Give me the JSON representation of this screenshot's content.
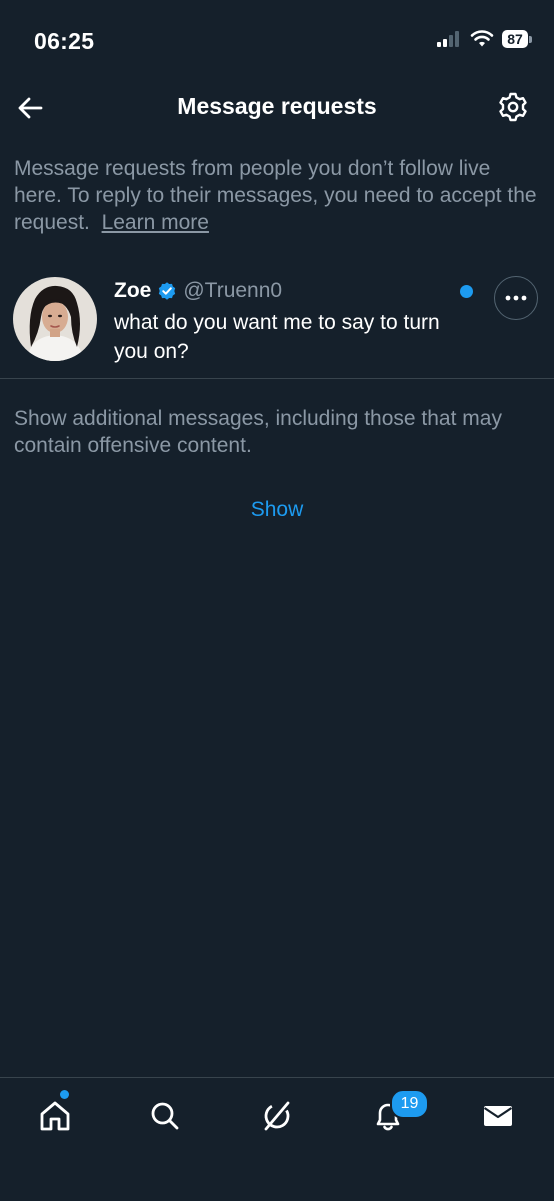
{
  "status_bar": {
    "time": "06:25",
    "battery_level": "87",
    "icons": [
      "cellular-signal-icon",
      "wifi-icon",
      "battery-icon"
    ]
  },
  "header": {
    "title": "Message requests",
    "back_icon": "arrow-left-icon",
    "settings_icon": "gear-icon"
  },
  "intro": {
    "text": "Message requests from people you don’t follow live here. To reply to their messages, you need to accept the request.",
    "learn_more": "Learn more"
  },
  "requests": [
    {
      "name": "Zoe",
      "verified": true,
      "handle": "@Truenn0",
      "message": "what do you want me to say to turn you on?",
      "unread": true
    }
  ],
  "additional": {
    "text": "Show additional messages, including those that may contain offensive content.",
    "show_label": "Show"
  },
  "bottom_nav": {
    "items": [
      "home-icon",
      "search-icon",
      "grok-icon",
      "notifications-icon",
      "messages-icon"
    ],
    "notifications_badge": "19"
  },
  "colors": {
    "background": "#15202b",
    "accent": "#1d9bf0",
    "secondary_text": "#8b98a5",
    "divider": "#38444d"
  }
}
